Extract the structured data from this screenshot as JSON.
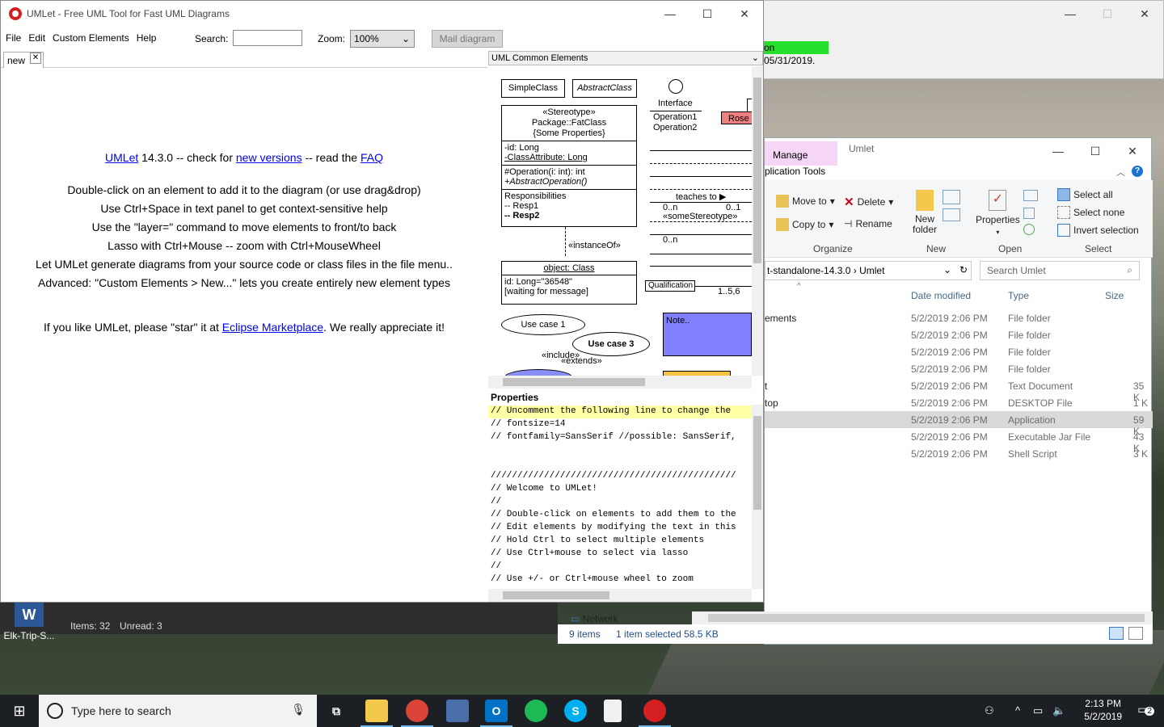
{
  "background_window": {
    "green_text": "on 05/31/2019."
  },
  "explorer": {
    "manage_tab": "Manage",
    "window_title": "Umlet",
    "app_tools_tab": "plication Tools",
    "ribbon": {
      "move_to": "Move to",
      "copy_to": "Copy to",
      "delete": "Delete",
      "rename": "Rename",
      "new_folder": "New\nfolder",
      "properties": "Properties",
      "select_all": "Select all",
      "select_none": "Select none",
      "invert_selection": "Invert selection",
      "group_organize": "Organize",
      "group_new": "New",
      "group_open": "Open",
      "group_select": "Select"
    },
    "address_path": "t-standalone-14.3.0  ›  Umlet",
    "search_placeholder": "Search Umlet",
    "columns": {
      "date": "Date modified",
      "type": "Type",
      "size": "Size"
    },
    "rows": [
      {
        "name": "ements",
        "date": "5/2/2019 2:06 PM",
        "type": "File folder",
        "size": ""
      },
      {
        "name": "",
        "date": "5/2/2019 2:06 PM",
        "type": "File folder",
        "size": ""
      },
      {
        "name": "",
        "date": "5/2/2019 2:06 PM",
        "type": "File folder",
        "size": ""
      },
      {
        "name": "",
        "date": "5/2/2019 2:06 PM",
        "type": "File folder",
        "size": ""
      },
      {
        "name": "t",
        "date": "5/2/2019 2:06 PM",
        "type": "Text Document",
        "size": "35 K"
      },
      {
        "name": "top",
        "date": "5/2/2019 2:06 PM",
        "type": "DESKTOP File",
        "size": "1 K"
      },
      {
        "name": "",
        "date": "5/2/2019 2:06 PM",
        "type": "Application",
        "size": "59 K"
      },
      {
        "name": "",
        "date": "5/2/2019 2:06 PM",
        "type": "Executable Jar File",
        "size": "43 K"
      },
      {
        "name": "",
        "date": "5/2/2019 2:06 PM",
        "type": "Shell Script",
        "size": "3 K"
      }
    ],
    "network": "Network",
    "status_items": "9 items",
    "status_selected": "1 item selected  58.5 KB"
  },
  "mail": {
    "items": "Items: 32",
    "unread": "Unread: 3"
  },
  "desktop_icon": {
    "label": "Elk-Trip-S..."
  },
  "umlet": {
    "title": "UMLet - Free UML Tool for Fast UML Diagrams",
    "menu": [
      "File",
      "Edit",
      "Custom Elements",
      "Help"
    ],
    "search_label": "Search:",
    "search_value": "",
    "zoom_label": "Zoom:",
    "zoom_value": "100%",
    "mail_button": "Mail diagram",
    "tab_name": "new",
    "info": {
      "line1_link1": "UMLet",
      "line1_mid": " 14.3.0 -- check for ",
      "line1_link2": "new versions",
      "line1_mid2": " -- read the ",
      "line1_link3": "FAQ",
      "lines": [
        "Double-click on an element to add it to the diagram (or use drag&drop)",
        "Use Ctrl+Space in text panel to get context-sensitive help",
        "Use the \"layer=\" command to move elements to front/to back",
        "Lasso with Ctrl+Mouse -- zoom with Ctrl+MouseWheel",
        "Let UMLet generate diagrams from your source code or class files in the file menu..",
        "Advanced: \"Custom Elements > New...\" lets you create entirely new element types"
      ],
      "star_pre": "If you like UMLet, please \"star\" it at ",
      "star_link": "Eclipse Marketplace",
      "star_post": ". We really appreciate it!"
    },
    "palette": {
      "header": "UML Common Elements",
      "simple_class": "SimpleClass",
      "abstract_class": "AbstractClass",
      "interface": "Interface",
      "operation1": "Operation1",
      "operation2": "Operation2",
      "rose": "Rose",
      "fat_stereotype": "«Stereotype»",
      "fat_package": "Package::FatClass",
      "fat_props": "{Some Properties}",
      "fat_id": "-id: Long",
      "fat_attr": "-ClassAttribute: Long",
      "fat_op1": "#Operation(i: int): int",
      "fat_op2": "+AbstractOperation()",
      "fat_resp": "Responsibilities",
      "fat_resp1": "-- Resp1",
      "fat_resp2": "-- Resp2",
      "instance_of": "«instanceOf»",
      "teaches_to": "teaches to ▶",
      "mult_0n": "0..n",
      "mult_01": "0..1",
      "some_stereotype": "«someStereotype»",
      "mult_0n_b": "0..n",
      "object_class": "object: Class",
      "object_id": "id: Long=\"36548\"",
      "object_wait": "[waiting for message]",
      "qualification": "Qualification",
      "mult_156": "1..5,6",
      "use_case1": "Use case 1",
      "use_case3": "Use case 3",
      "include": "«include»",
      "extends": "«extends»",
      "note": "Note.."
    },
    "properties_header": "Properties",
    "properties_lines": [
      "// Uncomment the following line to change the",
      "// fontsize=14",
      "// fontfamily=SansSerif //possible: SansSerif,",
      "",
      "",
      "//////////////////////////////////////////////",
      "// Welcome to UMLet!",
      "//",
      "// Double-click on elements to add them to the",
      "// Edit elements by modifying the text in this",
      "// Hold Ctrl to select multiple elements",
      "// Use Ctrl+mouse to select via lasso",
      "//",
      "// Use +/- or Ctrl+mouse wheel to zoom"
    ]
  },
  "taskbar": {
    "search_placeholder": "Type here to search",
    "time": "2:13 PM",
    "date": "5/2/2019",
    "notif_count": "2"
  }
}
